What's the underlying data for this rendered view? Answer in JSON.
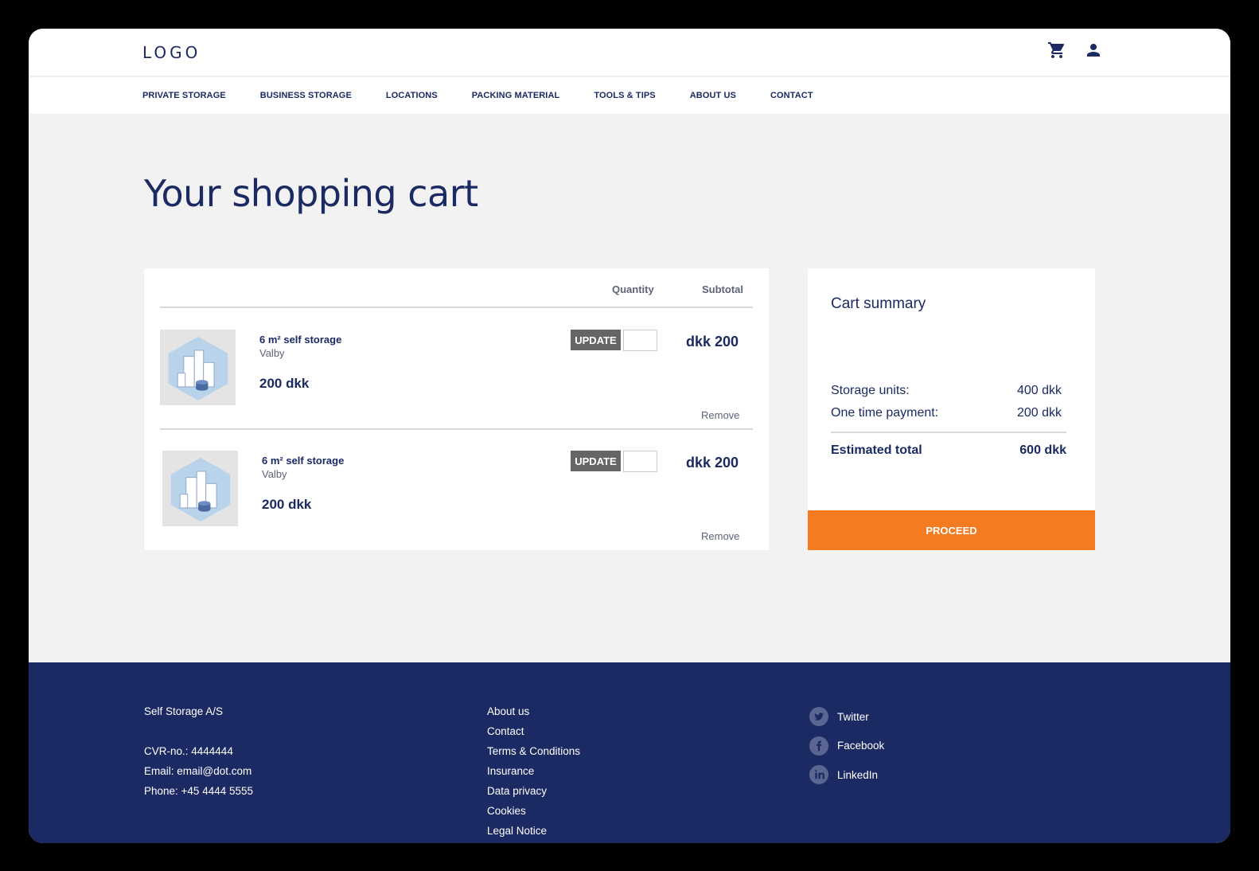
{
  "header": {
    "logo": "LOGO",
    "icons": [
      "cart-icon",
      "user-icon"
    ]
  },
  "nav": {
    "items": [
      "PRIVATE STORAGE",
      "BUSINESS STORAGE",
      "LOCATIONS",
      "PACKING MATERIAL",
      "TOOLS & TIPS",
      "ABOUT US",
      "CONTACT"
    ]
  },
  "page": {
    "title": "Your shopping cart"
  },
  "cart": {
    "columns": {
      "quantity": "Quantity",
      "subtotal": "Subtotal"
    },
    "items": [
      {
        "name": "6 m² self storage",
        "location": "Valby",
        "price": "200 dkk",
        "update_label": "UPDATE",
        "subtotal": "dkk 200",
        "remove_label": "Remove"
      },
      {
        "name": "6 m² self storage",
        "location": "Valby",
        "price": "200 dkk",
        "update_label": "UPDATE",
        "subtotal": "dkk 200",
        "remove_label": "Remove"
      }
    ]
  },
  "summary": {
    "title": "Cart summary",
    "storage_units_label": "Storage units:",
    "storage_units_value": "400 dkk",
    "one_time_label": "One time payment:",
    "one_time_value": "200 dkk",
    "total_label": "Estimated total",
    "total_value": "600 dkk",
    "proceed_label": "PROCEED"
  },
  "footer": {
    "company": "Self Storage A/S",
    "cvr": "CVR-no.: 4444444",
    "email": "Email: email@dot.com",
    "phone": "Phone: +45 4444 5555",
    "links": [
      "About us",
      "Contact",
      "Terms & Conditions",
      "Insurance",
      "Data privacy",
      "Cookies",
      "Legal Notice"
    ],
    "social": [
      "Twitter",
      "Facebook",
      "LinkedIn"
    ]
  },
  "colors": {
    "navy": "#1b2a63",
    "accent": "#f47b20",
    "background": "#f2f2f2",
    "update_button": "#666666"
  }
}
